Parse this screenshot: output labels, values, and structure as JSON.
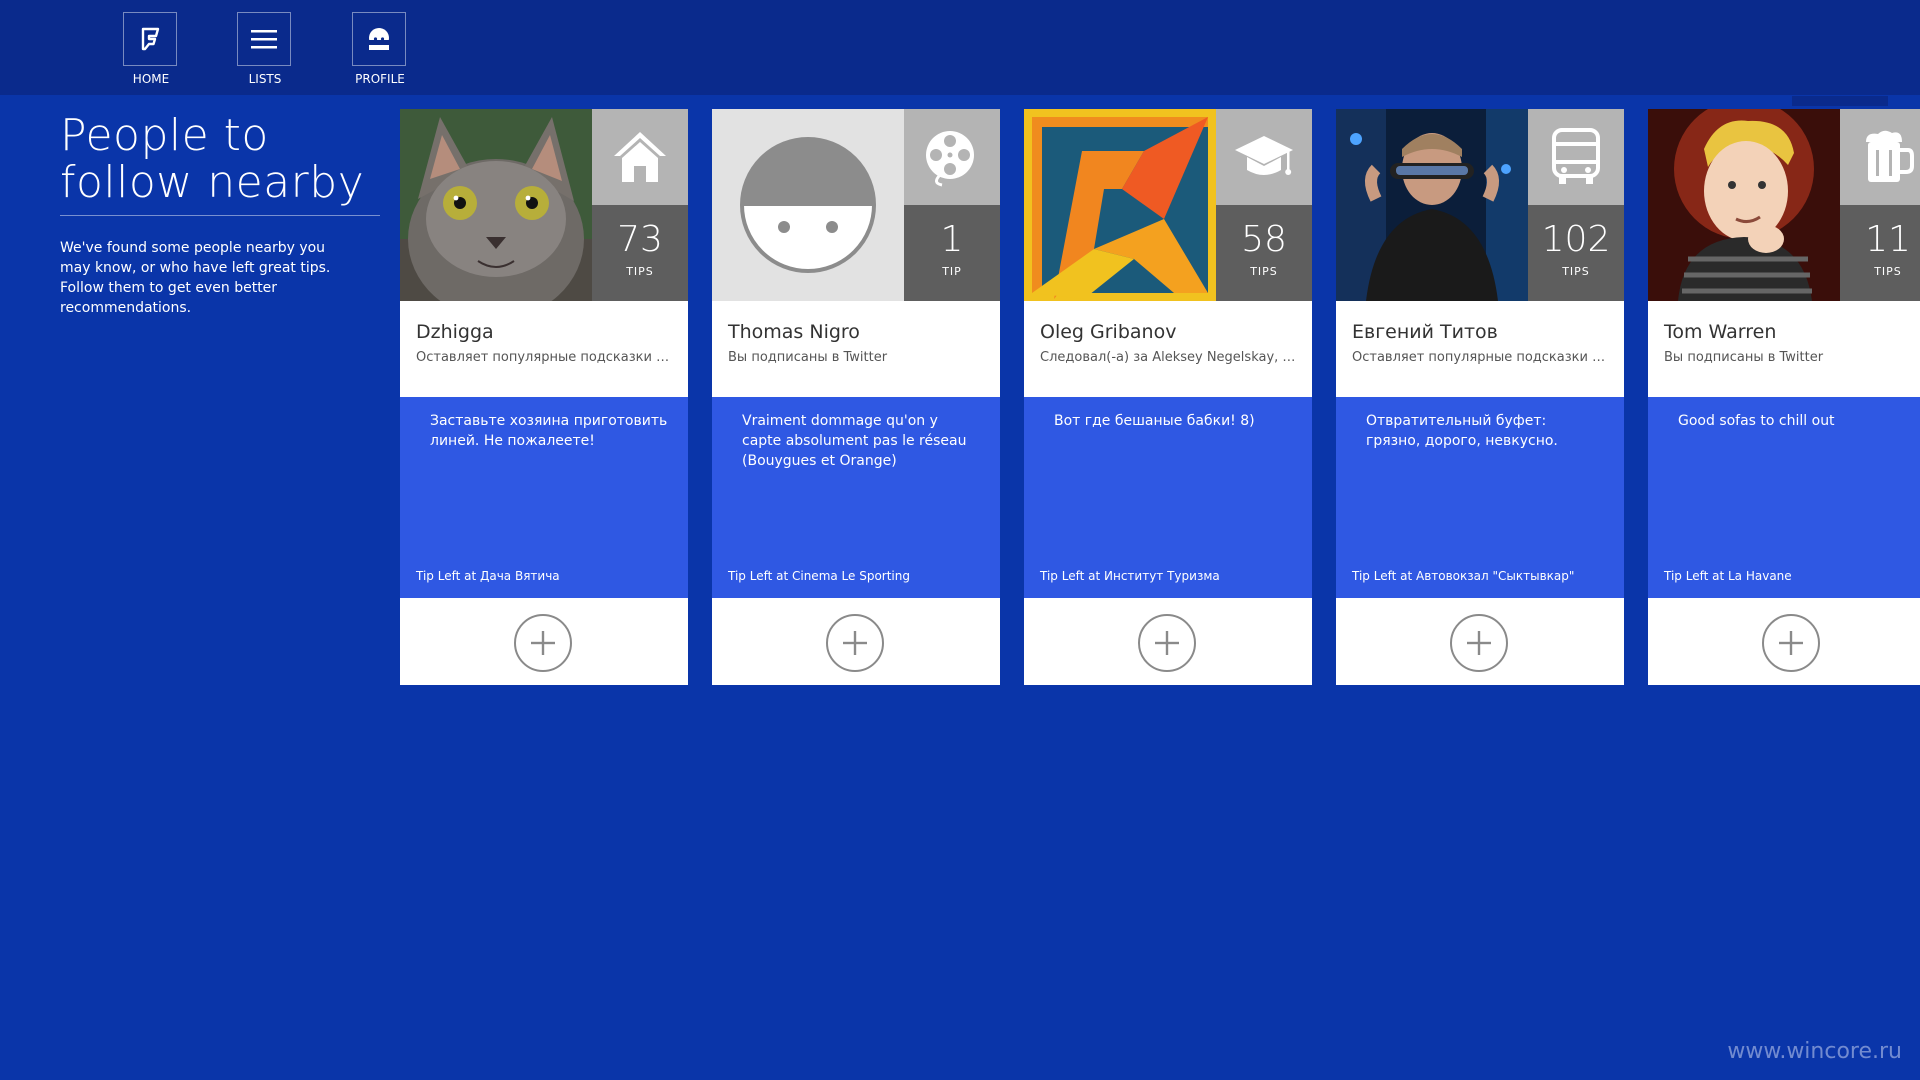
{
  "appbar": {
    "buttons": [
      {
        "label": "HOME",
        "icon": "foursquare-logo-icon"
      },
      {
        "label": "LISTS",
        "icon": "list-icon"
      },
      {
        "label": "PROFILE",
        "icon": "profile-icon"
      }
    ]
  },
  "page": {
    "title_line1": "People to",
    "title_line2": "follow nearby",
    "description": "We've found some people nearby you may know, or who have left great tips. Follow them to get even better recommendations."
  },
  "cards": [
    {
      "name": "Dzhigga",
      "subtitle": "Оставляет популярные подсказки в К...",
      "count": "73",
      "count_unit": "TIPS",
      "category_icon": "home-icon",
      "tip": "Заставьте хозяина приготовить линей. Не пожалеете!",
      "location": "Tip Left at Дача Вятича",
      "photo": "cat-photo"
    },
    {
      "name": "Thomas Nigro",
      "subtitle": "Вы подписаны в Twitter",
      "count": "1",
      "count_unit": "TIP",
      "category_icon": "film-reel-icon",
      "tip": "Vraiment dommage qu'on y capte absolument pas le réseau (Bouygues et Orange)",
      "location": "Tip Left at Cinema Le Sporting",
      "photo": "default-avatar"
    },
    {
      "name": "Oleg Gribanov",
      "subtitle": "Следовал(-а) за Aleksey Negelskay, Вл...",
      "count": "58",
      "count_unit": "TIPS",
      "category_icon": "graduation-cap-icon",
      "tip": "Вот где бешаные бабки! 8)",
      "location": "Tip Left at Институт Туризма",
      "photo": "logo-k"
    },
    {
      "name": "Евгений Титов",
      "subtitle": "Оставляет популярные подсказки в К...",
      "count": "102",
      "count_unit": "TIPS",
      "category_icon": "bus-icon",
      "tip": "Отвратительный буфет: грязно, дорого, невкусно.",
      "location": "Tip Left at Автовокзал \"Сыктывкар\"",
      "photo": "man-visor"
    },
    {
      "name": "Tom Warren",
      "subtitle": "Вы подписаны в Twitter",
      "count": "11",
      "count_unit": "TIPS",
      "category_icon": "beer-mug-icon",
      "tip": "Good sofas to chill out",
      "location": "Tip Left at La Havane",
      "photo": "cartoon-portrait"
    }
  ],
  "watermark": "www.wincore.ru",
  "colors": {
    "background": "#0a35a9",
    "appbar": "#0a2a8c",
    "tip_panel": "#2f58e3",
    "count_tile": "#5e5e5e",
    "category_tile": "#b4b4b4"
  }
}
